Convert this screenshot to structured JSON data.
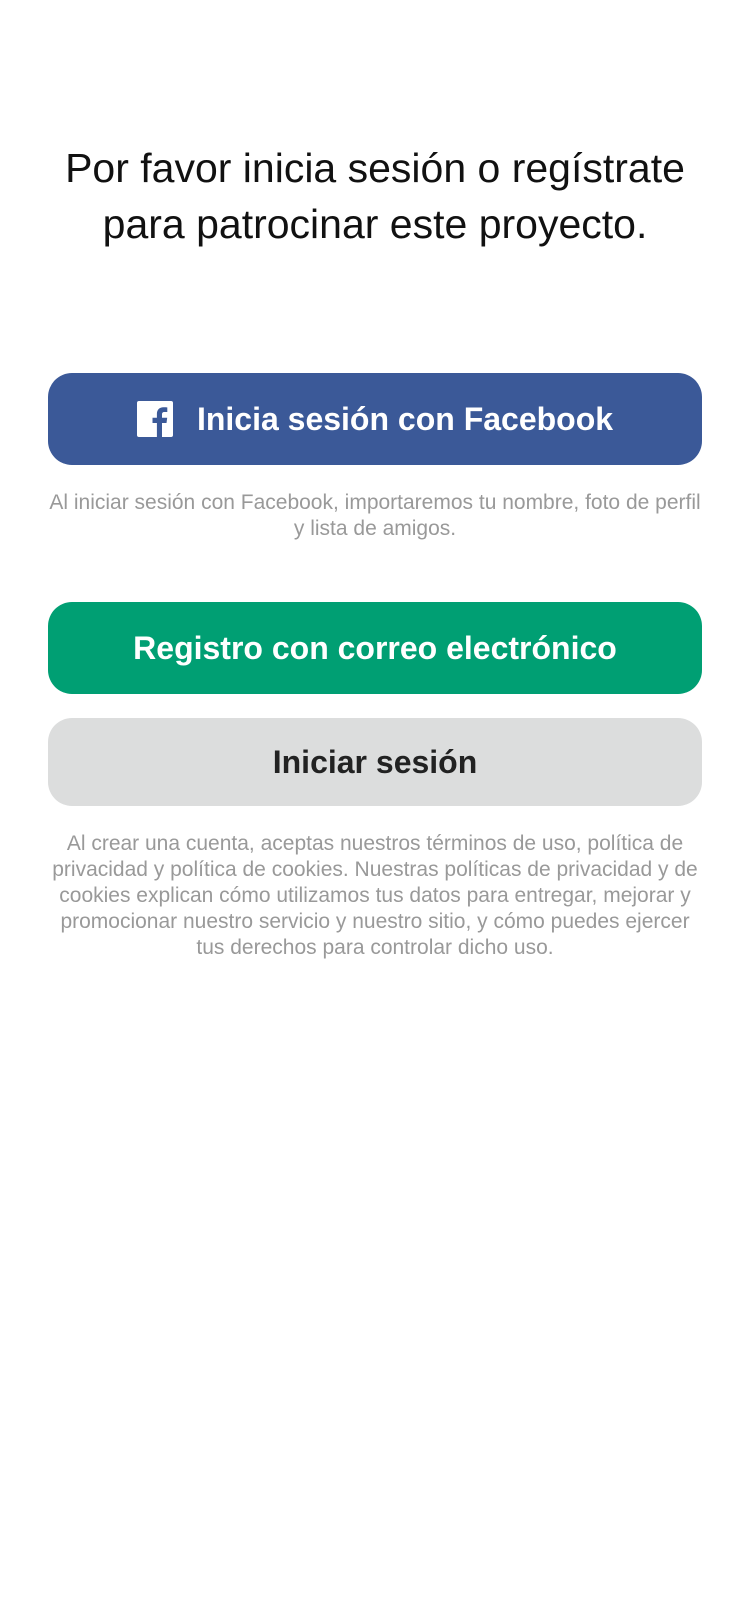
{
  "headline": "Por favor inicia sesión o regístrate para patrocinar este proyecto.",
  "facebook_button": {
    "label": "Inicia sesión con Facebook",
    "icon": "facebook-icon",
    "color": "#3b5998"
  },
  "facebook_note": "Al iniciar sesión con Facebook, importaremos tu nombre, foto de perfil y lista de amigos.",
  "email_button": {
    "label": "Registro con correo electrónico",
    "color": "#009f73"
  },
  "login_button": {
    "label": "Iniciar sesión",
    "color": "#dcdddd"
  },
  "terms_note": "Al crear una cuenta, aceptas nuestros términos de uso, política de privacidad y política de cookies. Nuestras políticas de privacidad y de cookies explican cómo utilizamos tus datos para entregar, mejorar y promocionar nuestro servicio y nuestro sitio, y cómo puedes ejercer tus derechos para controlar dicho uso."
}
